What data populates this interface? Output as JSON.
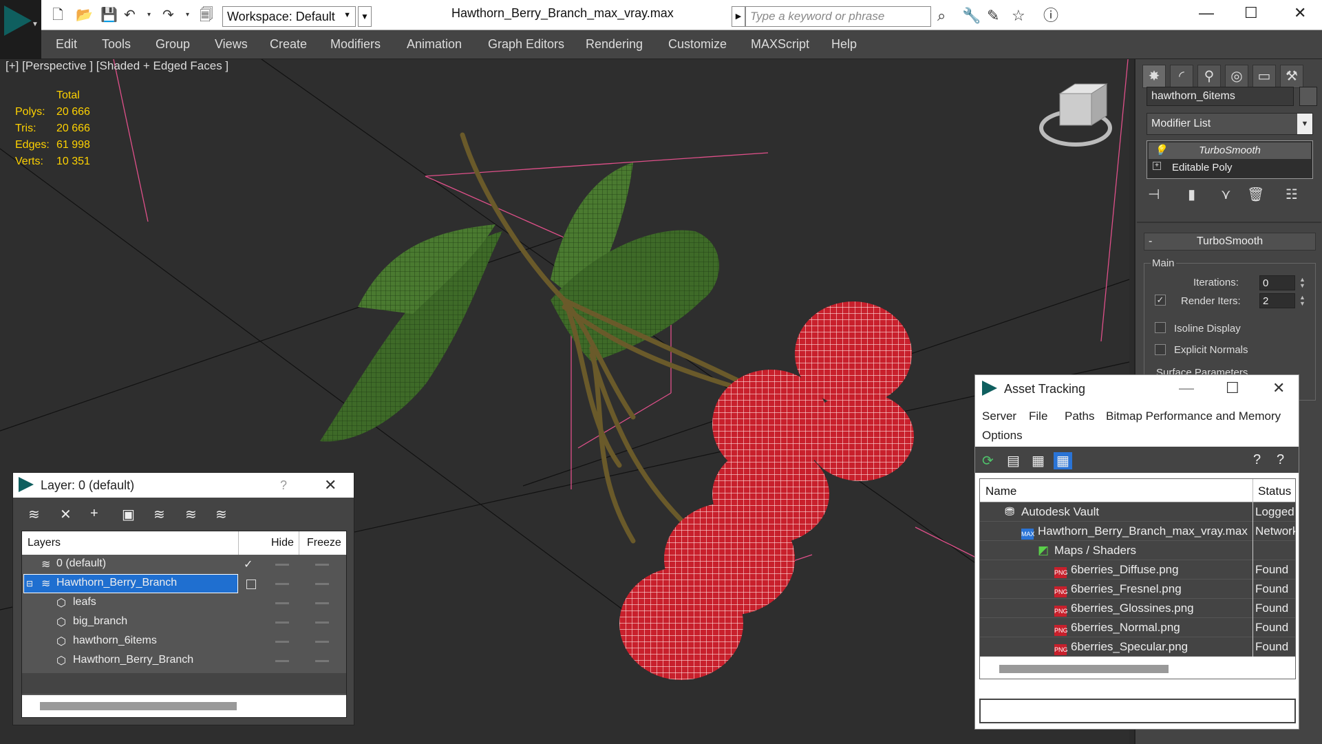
{
  "app": {
    "document_title": "Hawthorn_Berry_Branch_max_vray.max",
    "workspace_label": "Workspace: Default",
    "search_placeholder": "Type a keyword or phrase"
  },
  "menu": [
    "Edit",
    "Tools",
    "Group",
    "Views",
    "Create",
    "Modifiers",
    "Animation",
    "Graph Editors",
    "Rendering",
    "Customize",
    "MAXScript",
    "Help"
  ],
  "viewport": {
    "label": "[+] [Perspective ] [Shaded + Edged Faces ]",
    "stats": {
      "header": "Total",
      "rows": [
        {
          "label": "Polys:",
          "value": "20 666"
        },
        {
          "label": "Tris:",
          "value": "20 666"
        },
        {
          "label": "Edges:",
          "value": "61 998"
        },
        {
          "label": "Verts:",
          "value": "10 351"
        }
      ]
    }
  },
  "command_panel": {
    "object_name": "hawthorn_6items",
    "modifier_list": "Modifier List",
    "stack": [
      "TurboSmooth",
      "Editable Poly"
    ],
    "rollout_title": "TurboSmooth",
    "group_main": "Main",
    "iterations_label": "Iterations:",
    "iterations_value": "0",
    "render_iters_label": "Render Iters:",
    "render_iters_value": "2",
    "isoline_label": "Isoline Display",
    "explicit_normals_label": "Explicit Normals",
    "surface_params_label": "Surface Parameters"
  },
  "layer_dialog": {
    "title": "Layer: 0 (default)",
    "help": "?",
    "columns": {
      "layers": "Layers",
      "hide": "Hide",
      "freeze": "Freeze"
    },
    "rows": [
      {
        "name": "0 (default)",
        "indent": 0,
        "selected": false,
        "current": true
      },
      {
        "name": "Hawthorn_Berry_Branch",
        "indent": 0,
        "selected": true,
        "current": false
      },
      {
        "name": "leafs",
        "indent": 1,
        "selected": false,
        "current": false
      },
      {
        "name": "big_branch",
        "indent": 1,
        "selected": false,
        "current": false
      },
      {
        "name": "hawthorn_6items",
        "indent": 1,
        "selected": false,
        "current": false
      },
      {
        "name": "Hawthorn_Berry_Branch",
        "indent": 1,
        "selected": false,
        "current": false
      }
    ]
  },
  "asset_dialog": {
    "title": "Asset Tracking",
    "menu": [
      "Server",
      "File",
      "Paths",
      "Bitmap Performance and Memory",
      "Options"
    ],
    "columns": {
      "name": "Name",
      "status": "Status"
    },
    "rows": [
      {
        "name": "Autodesk Vault",
        "status": "Logged",
        "indent": 0,
        "icon": "vault-icon"
      },
      {
        "name": "Hawthorn_Berry_Branch_max_vray.max",
        "status": "Network",
        "indent": 1,
        "icon": "max-file-icon"
      },
      {
        "name": "Maps / Shaders",
        "status": "",
        "indent": 2,
        "icon": "maps-folder-icon"
      },
      {
        "name": "6berries_Diffuse.png",
        "status": "Found",
        "indent": 3,
        "icon": "png-icon"
      },
      {
        "name": "6berries_Fresnel.png",
        "status": "Found",
        "indent": 3,
        "icon": "png-icon"
      },
      {
        "name": "6berries_Glossines.png",
        "status": "Found",
        "indent": 3,
        "icon": "png-icon"
      },
      {
        "name": "6berries_Normal.png",
        "status": "Found",
        "indent": 3,
        "icon": "png-icon"
      },
      {
        "name": "6berries_Specular.png",
        "status": "Found",
        "indent": 3,
        "icon": "png-icon"
      }
    ]
  },
  "colors": {
    "stats": "#ffd200",
    "selection": "#1f6fd0",
    "berry": "#c8202c",
    "leaf": "#3e6a28",
    "branch": "#6a5a2a",
    "viewport_bg": "#2e2e2e",
    "grid_pink": "#e0508a"
  }
}
